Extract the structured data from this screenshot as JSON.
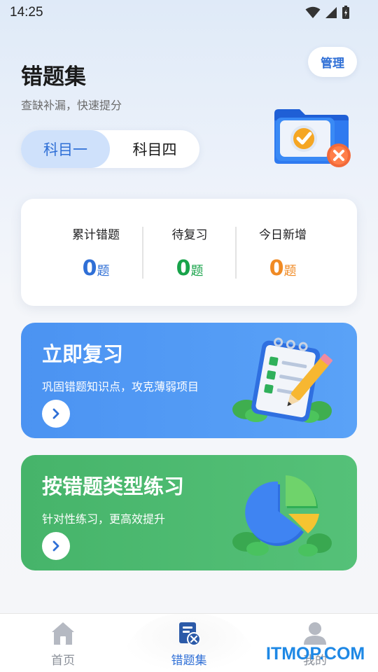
{
  "status_bar": {
    "time": "14:25"
  },
  "header": {
    "title": "错题集",
    "subtitle": "查缺补漏，快速提分",
    "manage_label": "管理",
    "tabs": [
      {
        "label": "科目一",
        "active": true
      },
      {
        "label": "科目四",
        "active": false
      }
    ]
  },
  "stats": [
    {
      "label": "累计错题",
      "value": "0",
      "unit": "题",
      "color": "#2f6fd6"
    },
    {
      "label": "待复习",
      "value": "0",
      "unit": "题",
      "color": "#18a34a"
    },
    {
      "label": "今日新增",
      "value": "0",
      "unit": "题",
      "color": "#f08a24"
    }
  ],
  "cards": [
    {
      "title": "立即复习",
      "desc": "巩固错题知识点，攻克薄弱项目",
      "icon": "checklist-pencil-icon"
    },
    {
      "title": "按错题类型练习",
      "desc": "针对性练习，更高效提升",
      "icon": "pie-chart-icon"
    }
  ],
  "bottom_nav": [
    {
      "label": "首页",
      "icon": "home-icon",
      "active": false
    },
    {
      "label": "错题集",
      "icon": "wrong-questions-icon",
      "active": true
    },
    {
      "label": "我的",
      "icon": "user-icon",
      "active": false
    }
  ],
  "watermark": "ITMOP.COM",
  "colors": {
    "primary": "#2f6fd6",
    "green": "#18a34a",
    "orange": "#f08a24",
    "card_blue": "#4b93f2",
    "card_green": "#46b46a"
  }
}
